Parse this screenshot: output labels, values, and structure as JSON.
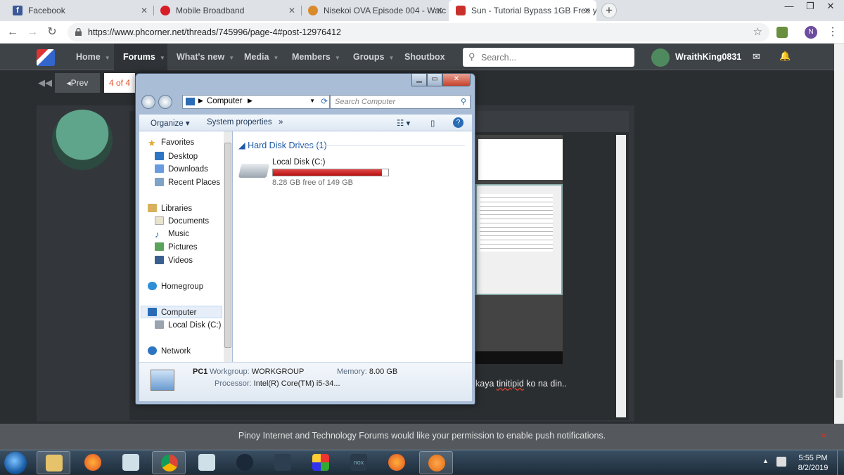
{
  "browser": {
    "tabs": [
      {
        "title": "Facebook",
        "color": "#3b5998"
      },
      {
        "title": "Mobile Broadband",
        "color": "#d71e28"
      },
      {
        "title": "Nisekoi OVA Episode 004 - Watc",
        "color": "#d98b2b"
      },
      {
        "title": "Sun - Tutorial Bypass 1GB Free y",
        "color": "#c9302c"
      }
    ],
    "url": "https://www.phcorner.net/threads/745996/page-4#post-12976412",
    "profile_initial": "N"
  },
  "site": {
    "nav": [
      {
        "label": "Home"
      },
      {
        "label": "Forums"
      },
      {
        "label": "What's new"
      },
      {
        "label": "Media"
      },
      {
        "label": "Members"
      },
      {
        "label": "Groups"
      },
      {
        "label": "Shoutbox"
      }
    ],
    "search_placeholder": "Search...",
    "username": "WraithKing0831",
    "prev_label": "Prev",
    "page_indicator": "4 of 4",
    "post_text_prefix": "kaya ",
    "post_text_underlined": "tinitipid",
    "post_text_suffix": " ko na din..",
    "notification": "Pinoy Internet and Technology Forums would like your permission to enable push notifications."
  },
  "explorer": {
    "address": "Computer",
    "search_placeholder": "Search Computer",
    "organize": "Organize",
    "system_properties": "System properties",
    "more": "»",
    "nav": {
      "favorites": "Favorites",
      "desktop": "Desktop",
      "downloads": "Downloads",
      "recent": "Recent Places",
      "libraries": "Libraries",
      "documents": "Documents",
      "music": "Music",
      "pictures": "Pictures",
      "videos": "Videos",
      "homegroup": "Homegroup",
      "computer": "Computer",
      "localdisk": "Local Disk (C:)",
      "network": "Network"
    },
    "group_header": "Hard Disk Drives (1)",
    "drive_name": "Local Disk (C:)",
    "drive_free": "8.28 GB free of 149 GB",
    "drive_used_fraction": 0.944,
    "pc_name": "PC1",
    "workgroup_label": "Workgroup:",
    "workgroup": "WORKGROUP",
    "memory_label": "Memory:",
    "memory": "8.00 GB",
    "processor_label": "Processor:",
    "processor": "Intel(R) Core(TM) i5-34..."
  },
  "taskbar": {
    "time": "5:55 PM",
    "date": "8/2/2019"
  }
}
